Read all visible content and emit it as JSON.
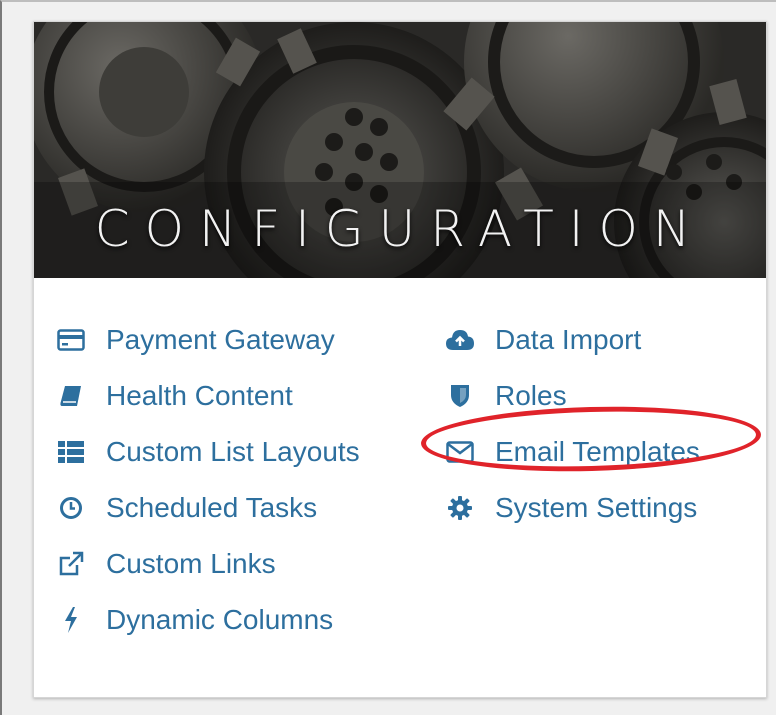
{
  "banner": {
    "title": "CONFIGURATION"
  },
  "left_links": [
    {
      "label": "Payment Gateway",
      "icon": "credit-card-icon"
    },
    {
      "label": "Health Content",
      "icon": "book-icon"
    },
    {
      "label": "Custom List Layouts",
      "icon": "list-icon"
    },
    {
      "label": "Scheduled Tasks",
      "icon": "clock-icon"
    },
    {
      "label": "Custom Links",
      "icon": "external-link-icon"
    },
    {
      "label": "Dynamic Columns",
      "icon": "bolt-icon"
    }
  ],
  "right_links": [
    {
      "label": "Data Import",
      "icon": "cloud-upload-icon"
    },
    {
      "label": "Roles",
      "icon": "shield-icon"
    },
    {
      "label": "Email Templates",
      "icon": "envelope-icon"
    },
    {
      "label": "System Settings",
      "icon": "gear-icon"
    }
  ],
  "colors": {
    "link": "#2d6f9e",
    "highlight": "#e0232a"
  }
}
